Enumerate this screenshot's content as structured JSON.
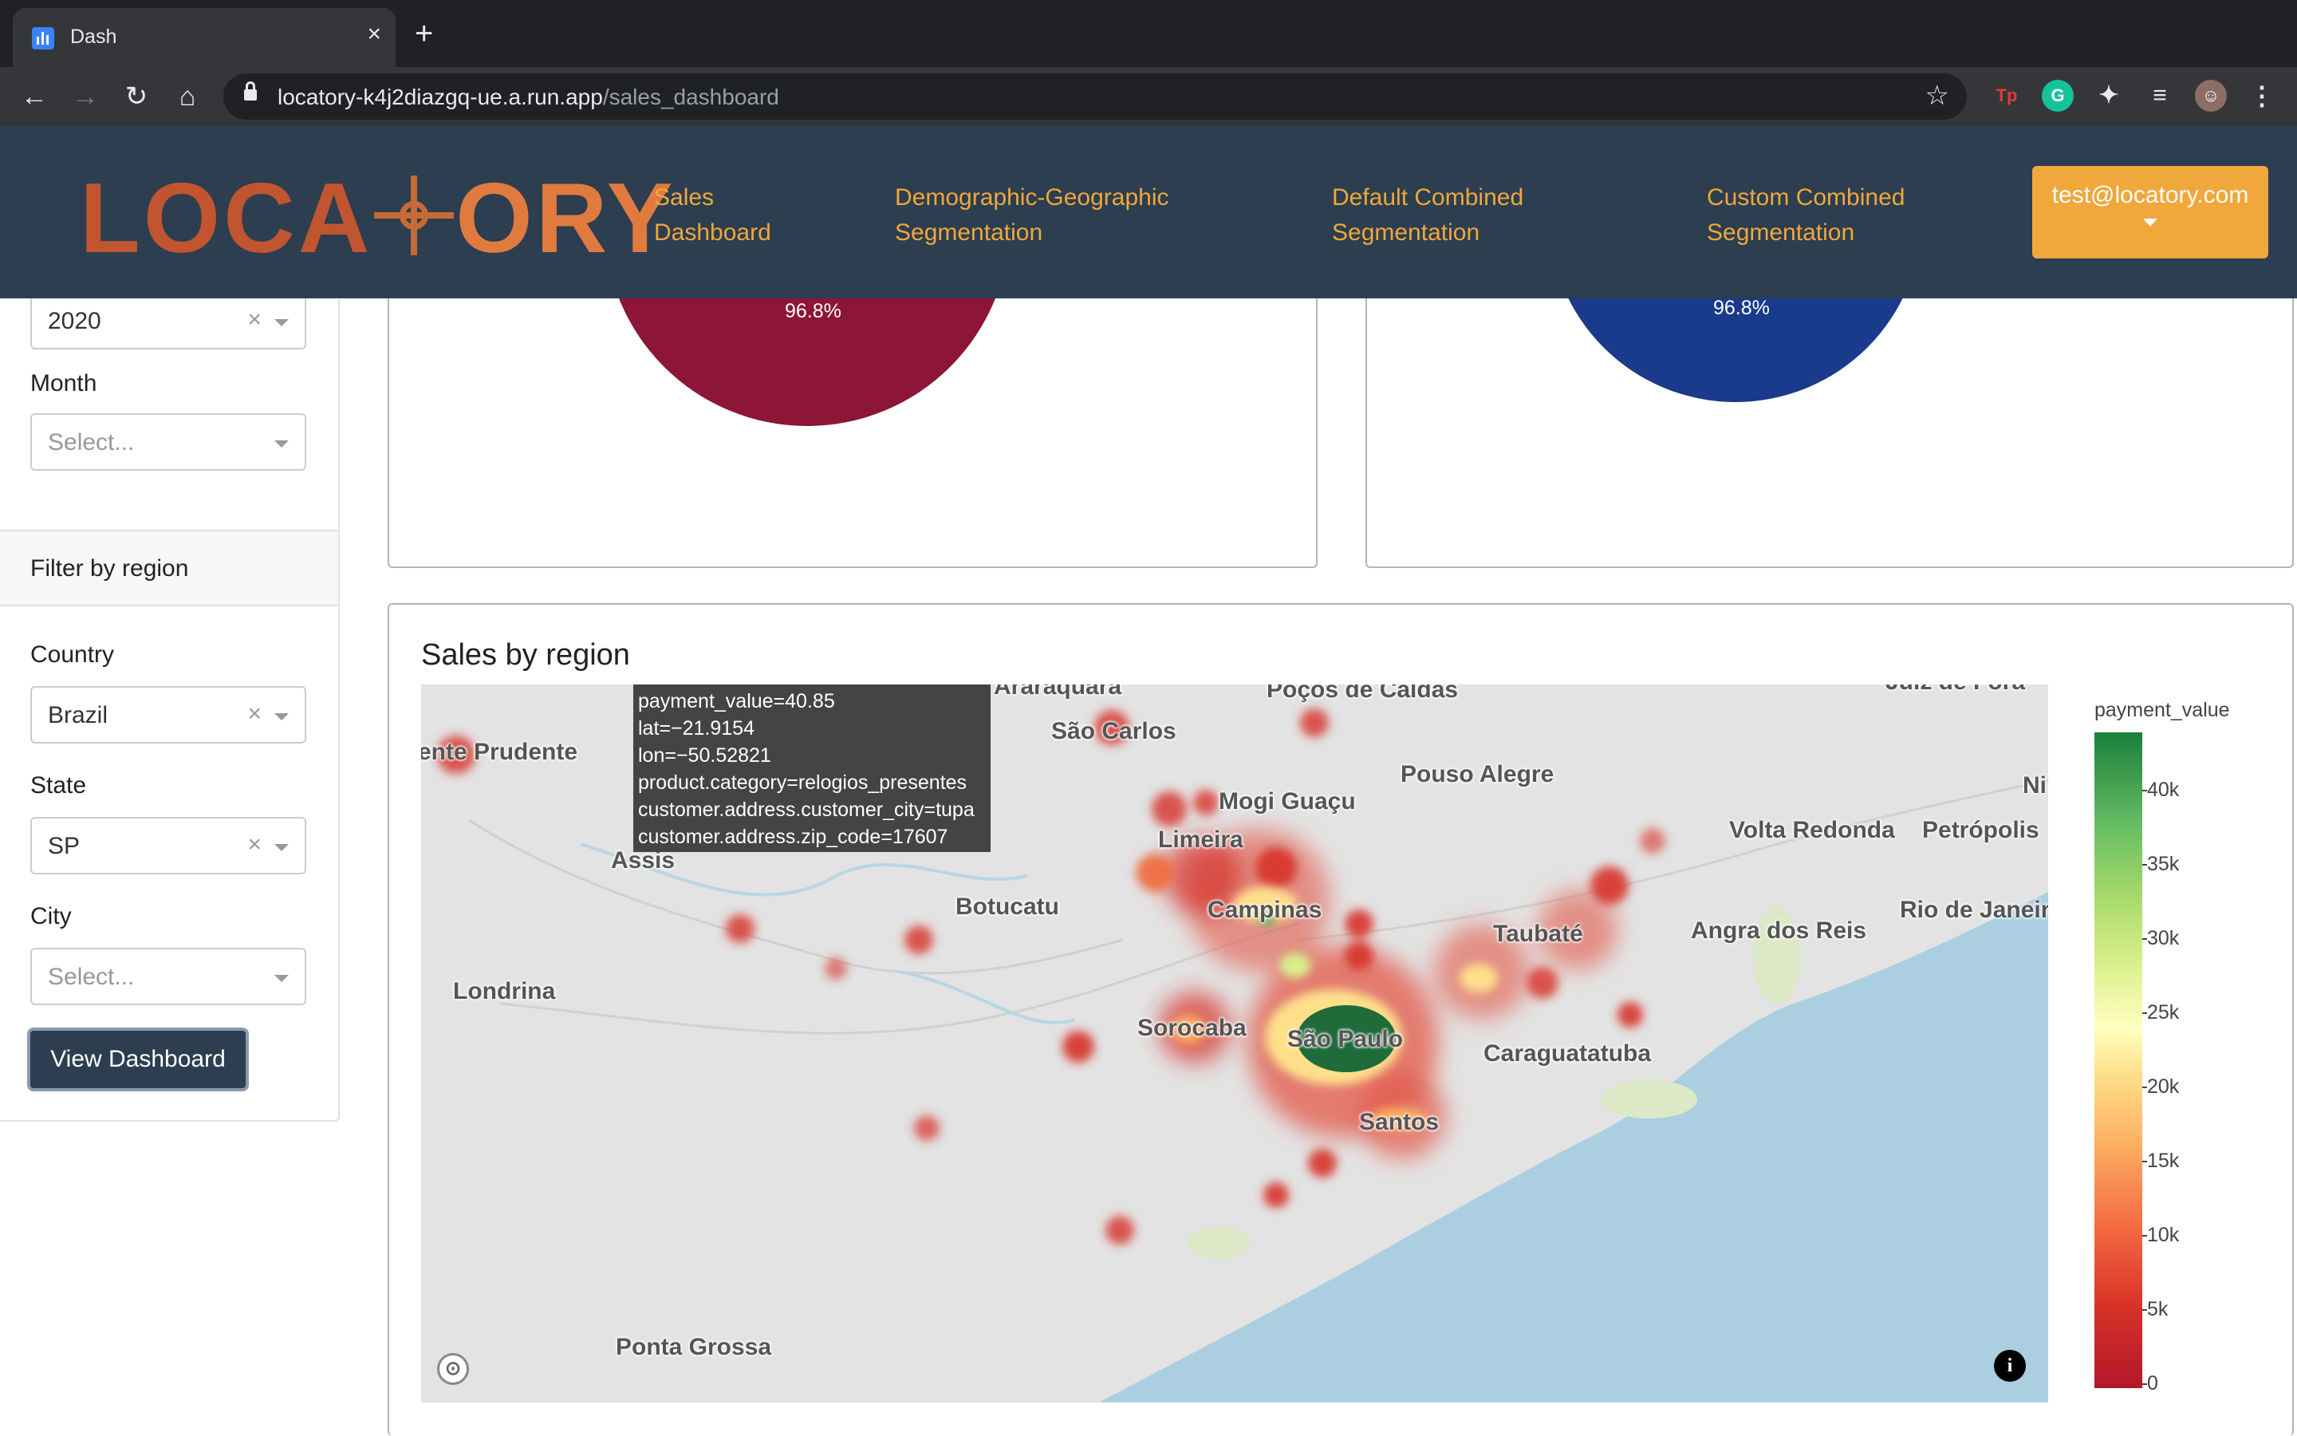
{
  "browser": {
    "tab_title": "Dash",
    "new_tab": "+",
    "close": "×",
    "url_host": "locatory-k4j2diazgq-ue.a.run.app",
    "url_path": "/sales_dashboard",
    "back": "←",
    "forward": "→",
    "reload": "↻",
    "home": "⌂",
    "star": "☆"
  },
  "navbar": {
    "logo_left": "LOCA",
    "logo_right": "ORY",
    "links": [
      {
        "line1": "Sales",
        "line2": "Dashboard"
      },
      {
        "line1": "Demographic-Geographic",
        "line2": "Segmentation"
      },
      {
        "line1": "Default Combined",
        "line2": "Segmentation"
      },
      {
        "line1": "Custom Combined",
        "line2": "Segmentation"
      }
    ],
    "user": "test@locatory.com",
    "colors": {
      "bg": "#2c3e50",
      "accent": "#f0a73b"
    }
  },
  "sidebar": {
    "year_value": "2020",
    "month_label": "Month",
    "month_placeholder": "Select...",
    "filter_header": "Filter by region",
    "country_label": "Country",
    "country_value": "Brazil",
    "state_label": "State",
    "state_value": "SP",
    "city_label": "City",
    "city_placeholder": "Select...",
    "clear_glyph": "×",
    "view_button": "View Dashboard"
  },
  "pies": {
    "left_label": "96.8%",
    "right_label": "96.8%",
    "left_color": "#8c1538",
    "right_color": "#1a3a8c"
  },
  "map_card": {
    "title": "Sales by region",
    "cities": [
      "Araraquara",
      "Poços de Caldas",
      "Juiz de Fora",
      "São Carlos",
      "ente Prudente",
      "Pouso Alegre",
      "Mogi Guaçu",
      "Limeira",
      "Assis",
      "Volta Redonda",
      "Petrópolis",
      "Ni",
      "Botucatu",
      "Campinas",
      "Rio de Janeiro",
      "Angra dos Reis",
      "Taubaté",
      "Londrina",
      "Sorocaba",
      "São Paulo",
      "Caraguatatuba",
      "Santos",
      "Ponta Grossa"
    ],
    "tooltip": [
      "payment_value=40.85",
      "lat=−21.9154",
      "lon=−50.52821",
      "product.category=relogios_presentes",
      "customer.address.customer_city=tupa",
      "customer.address.zip_code=17607"
    ],
    "info_glyph": "i",
    "attrib_glyph": "⊙",
    "colorbar_title": "payment_value",
    "colorbar_ticks": [
      "40k",
      "35k",
      "30k",
      "25k",
      "20k",
      "15k",
      "10k",
      "5k",
      "0"
    ]
  },
  "chart_data": {
    "type": "heatmap",
    "title": "Sales by region",
    "colorbar": {
      "title": "payment_value",
      "range": [
        0,
        44000
      ],
      "ticks": [
        0,
        5000,
        10000,
        15000,
        20000,
        25000,
        30000,
        35000,
        40000
      ]
    },
    "hover_point": {
      "payment_value": 40.85,
      "lat": -21.9154,
      "lon": -50.52821,
      "product.category": "relogios_presentes",
      "customer.address.customer_city": "tupa",
      "customer.address.zip_code": 17607
    }
  }
}
